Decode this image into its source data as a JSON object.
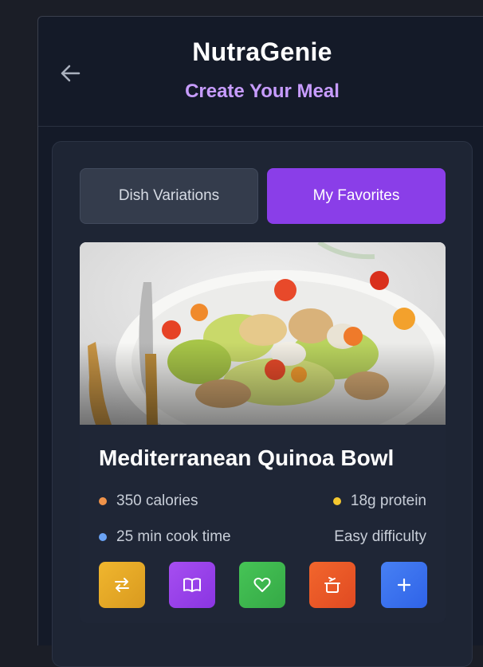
{
  "header": {
    "title": "NutraGenie",
    "subtitle": "Create Your Meal",
    "back_icon": "arrow-left-icon"
  },
  "tabs": [
    {
      "label": "Dish Variations",
      "active": false
    },
    {
      "label": "My Favorites",
      "active": true
    }
  ],
  "dish": {
    "title": "Mediterranean Quinoa Bowl",
    "calories": "350 calories",
    "protein": "18g protein",
    "cook_time": "25 min cook time",
    "difficulty": "Easy difficulty"
  },
  "colors": {
    "accent": "#8a3ee8",
    "subtitle": "#c79cff",
    "calories_dot": "#f0934a",
    "protein_dot": "#f5c82f",
    "cooktime_dot": "#6aa3f5"
  },
  "actions": [
    {
      "icon": "swap-icon",
      "color": "#e6ad2a"
    },
    {
      "icon": "book-icon",
      "color": "#9b43ea"
    },
    {
      "icon": "heart-icon",
      "color": "#3fb850"
    },
    {
      "icon": "pot-icon",
      "color": "#ef5a2a"
    },
    {
      "icon": "plus-icon",
      "color": "#3c72ef"
    }
  ]
}
